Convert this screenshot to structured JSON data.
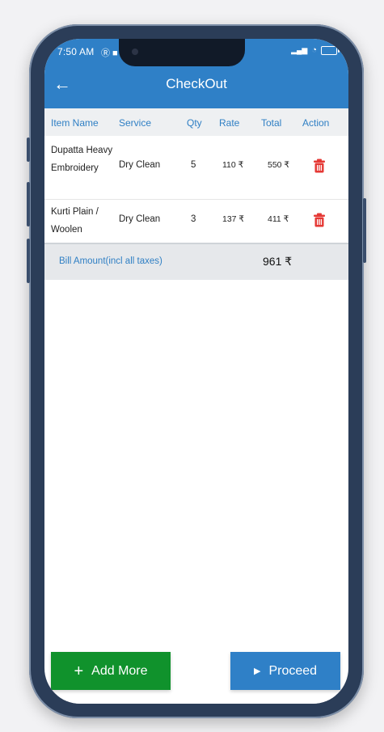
{
  "statusbar": {
    "time": "7:50 AM",
    "left_icons": "Ⓡ ■ ©",
    "signal": "▂▄▆",
    "wifi": "◔"
  },
  "header": {
    "title": "CheckOut",
    "back_icon": "←"
  },
  "table": {
    "columns": [
      "Item Name",
      "Service",
      "Qty",
      "Rate",
      "Total",
      "Action"
    ],
    "rows": [
      {
        "name": "Dupatta Heavy Embroidery",
        "service": "Dry Clean",
        "qty": "5",
        "rate": "110 ₹",
        "total": "550 ₹"
      },
      {
        "name": "Kurti Plain / Woolen",
        "service": "Dry Clean",
        "qty": "3",
        "rate": "137 ₹",
        "total": "411 ₹"
      }
    ]
  },
  "bill": {
    "label": "Bill Amount(incl all taxes)",
    "amount": "961 ₹"
  },
  "buttons": {
    "add_more": "Add More",
    "add_more_icon": "+",
    "proceed": "Proceed",
    "proceed_icon": "▶"
  },
  "colors": {
    "primary": "#2f80c7",
    "success": "#10922c",
    "danger": "#e53935",
    "frame": "#2b3d58"
  }
}
